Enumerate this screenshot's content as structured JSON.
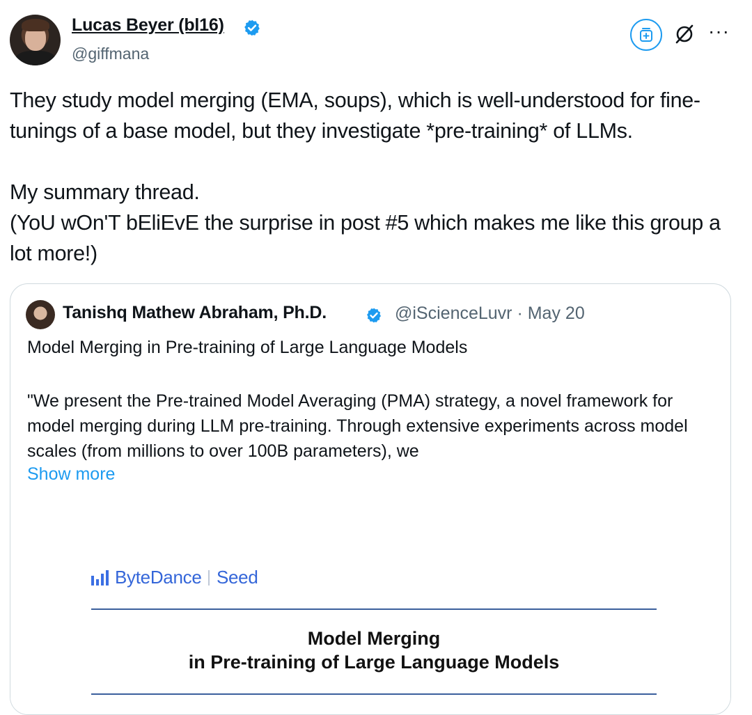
{
  "post": {
    "author_name": "Lucas Beyer (bl16)",
    "author_handle": "@giffmana",
    "text": [
      "They study model merging (EMA, soups), which is well-understood for fine-tunings of a base model, but they investigate *pre-training* of LLMs.",
      "My summary thread.",
      "(YoU wOn'T bEliEvE the surprise in post #5 which makes me like this group a lot more!)"
    ]
  },
  "quote": {
    "author_name": "Tanishq Mathew Abraham, Ph.D.",
    "author_handle": "@iScienceLuvr",
    "date": "May 20",
    "title": "Model Merging in Pre-training of Large Language Models",
    "body": "\"We present the Pre-trained Model Averaging (PMA) strategy, a novel framework for model merging during LLM pre-training. Through extensive experiments across model scales (from millions to over 100B parameters), we",
    "show_more": "Show more"
  },
  "paper": {
    "logo_brand": "ByteDance",
    "logo_sub": "Seed",
    "title_line1": "Model Merging",
    "title_line2": "in Pre-training of Large Language Models"
  },
  "colors": {
    "accent": "#1d9bf0",
    "muted": "#536471",
    "border": "#cfd9de",
    "bytedance_blue": "#3466d9"
  },
  "icons": [
    "grok-icon",
    "no-sign-icon",
    "more-icon",
    "verified-badge-icon"
  ]
}
